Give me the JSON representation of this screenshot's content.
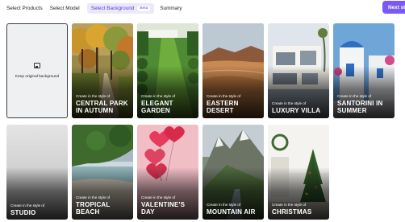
{
  "steps": {
    "select_products": "Select Products",
    "select_model": "Select Model",
    "select_background": "Select Background",
    "beta": "Beta",
    "summary": "Summary"
  },
  "next_label": "Next step",
  "keep_original": "Keep original background",
  "style_prefix": "Create in the style of",
  "cards": [
    {
      "title1": "CENTRAL PARK",
      "title2": "IN AUTUMN"
    },
    {
      "title1": "ELEGANT",
      "title2": "GARDEN"
    },
    {
      "title1": "EASTERN",
      "title2": "DESERT"
    },
    {
      "title1": "LUXURY VILLA",
      "title2": ""
    },
    {
      "title1": "SANTORINI IN",
      "title2": "SUMMER"
    },
    {
      "title1": "STUDIO",
      "title2": ""
    },
    {
      "title1": "TROPICAL",
      "title2": "BEACH"
    },
    {
      "title1": "VALENTINE'S",
      "title2": "DAY"
    },
    {
      "title1": "MOUNTAIN AIR",
      "title2": ""
    },
    {
      "title1": "CHRISTMAS",
      "title2": ""
    }
  ],
  "colors": {
    "accent": "#7a5af5",
    "active_step_bg": "#ece8fb"
  }
}
